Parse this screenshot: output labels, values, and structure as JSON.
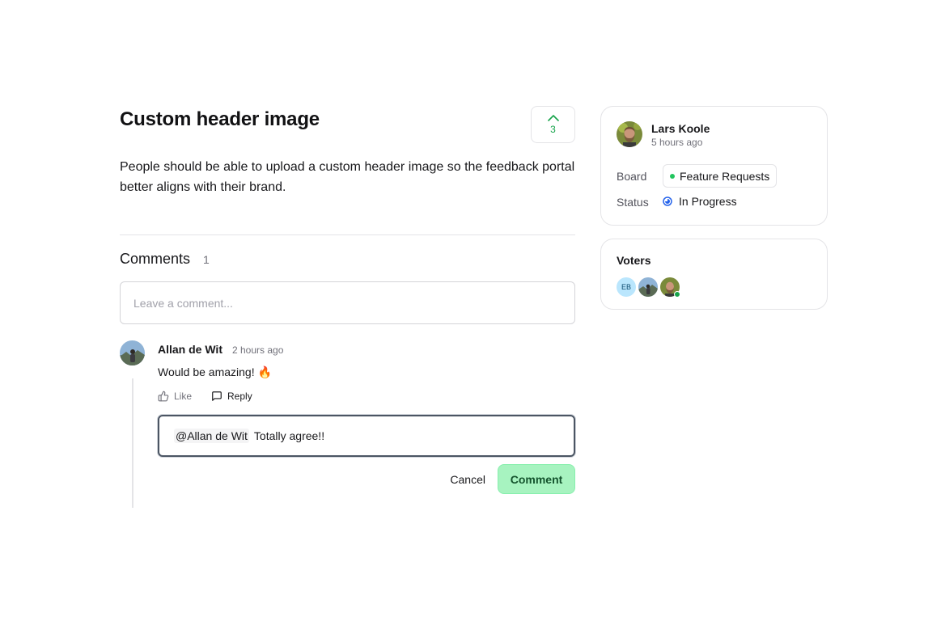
{
  "post": {
    "title": "Custom header image",
    "upvotes": "3",
    "body": "People should be able to upload a custom header image so the feedback portal better aligns with their brand."
  },
  "comments": {
    "title": "Comments",
    "count": "1",
    "placeholder": "Leave a comment...",
    "items": [
      {
        "author": "Allan de Wit",
        "time": "2 hours ago",
        "text": "Would be amazing! 🔥",
        "like_label": "Like",
        "reply_label": "Reply"
      }
    ],
    "reply": {
      "mention": "@Allan de Wit",
      "text": "Totally agree!!",
      "cancel_label": "Cancel",
      "submit_label": "Comment"
    }
  },
  "sidebar": {
    "author": {
      "name": "Lars Koole",
      "time": "5 hours ago"
    },
    "board_label": "Board",
    "board_value": "Feature Requests",
    "status_label": "Status",
    "status_value": "In Progress",
    "voters_title": "Voters",
    "voters": [
      {
        "initials": "EB"
      }
    ]
  },
  "colors": {
    "accent_green": "#16a34a",
    "comment_button": "#a7f3c0",
    "status_blue": "#2563eb"
  },
  "icons": [
    "chevron-up-icon",
    "thumbs-up-icon",
    "message-square-icon",
    "status-progress-icon"
  ]
}
